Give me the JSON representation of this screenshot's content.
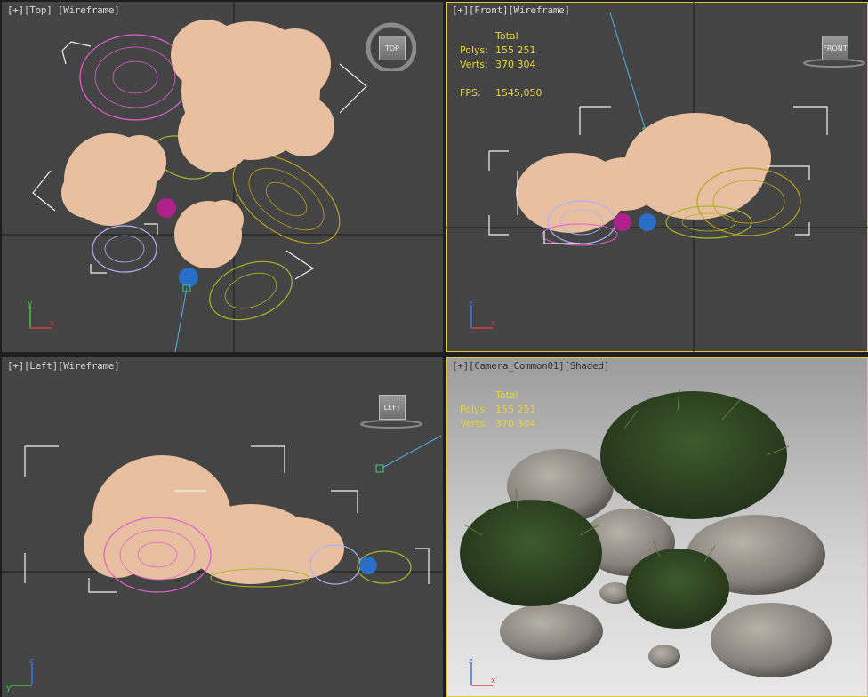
{
  "viewports": {
    "top": {
      "label": [
        "[+]",
        "[Top]",
        "[Wireframe]"
      ],
      "cube": "TOP"
    },
    "front": {
      "label": [
        "[+]",
        "[Front]",
        "[Wireframe]"
      ],
      "cube": "FRONT",
      "stats": {
        "total": "Total",
        "polys_key": "Polys:",
        "polys": "155 251",
        "verts_key": "Verts:",
        "verts": "370 304",
        "fps_key": "FPS:",
        "fps": "1545,050"
      }
    },
    "left": {
      "label": [
        "[+]",
        "[Left]",
        "[Wireframe]"
      ],
      "cube": "LEFT"
    },
    "camera": {
      "label": [
        "[+]",
        "[Camera_Common01]",
        "[Shaded]"
      ],
      "stats": {
        "total": "Total",
        "polys_key": "Polys:",
        "polys": "155 251",
        "verts_key": "Verts:",
        "verts": "370 304"
      }
    }
  },
  "axes": {
    "x": "x",
    "y": "y",
    "z": "z"
  },
  "colors": {
    "viewport_bg": "#444444",
    "active_border": "#e0c847",
    "stats_text": "#e7d43a",
    "tree_fill": "#e8bfa0",
    "pink_wire": "#e060d0",
    "olive_wire": "#b8a020",
    "lime_wire": "#a8b828",
    "lavender_wire": "#b0b0ff",
    "blue_sphere": "#2a6ec8"
  }
}
